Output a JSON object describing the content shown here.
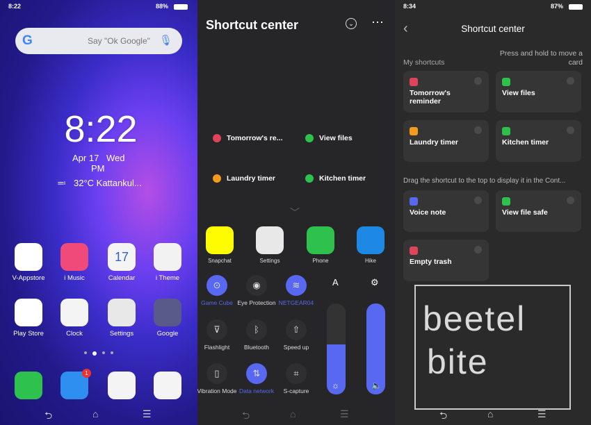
{
  "home": {
    "status_time": "8:22",
    "battery": "88%",
    "search_hint": "Say \"Ok Google\"",
    "clock": "8:22",
    "date": "Apr 17",
    "day": "Wed",
    "ampm": "PM",
    "weather": "32°C Kattankul...",
    "apps": [
      {
        "label": "V-Appstore",
        "color": "#ffffff",
        "icon": "appstore-icon"
      },
      {
        "label": "i Music",
        "color": "#f04a7a",
        "icon": "music-icon"
      },
      {
        "label": "Calendar",
        "color": "#f4f4f4",
        "icon": "calendar-icon",
        "day": "17",
        "weekday": "Wed"
      },
      {
        "label": "i Theme",
        "color": "#f2f2f2",
        "icon": "theme-icon"
      },
      {
        "label": "Play Store",
        "color": "#ffffff",
        "icon": "play-store-icon"
      },
      {
        "label": "Clock",
        "color": "#f4f4f4",
        "icon": "clock-icon"
      },
      {
        "label": "Settings",
        "color": "#e8e8e8",
        "icon": "settings-icon"
      },
      {
        "label": "Google",
        "color": "#5a5a8a",
        "icon": "google-folder-icon"
      }
    ],
    "dock": [
      {
        "icon": "phone-icon",
        "color": "#2ec14d"
      },
      {
        "icon": "messages-icon",
        "color": "#2f8ff0",
        "badge": "1"
      },
      {
        "icon": "browser-icon",
        "color": "#f4f4f4"
      },
      {
        "icon": "camera-icon",
        "color": "#f4f4f4"
      }
    ]
  },
  "control": {
    "title": "Shortcut center",
    "shortcuts": [
      {
        "label": "Tomorrow's re...",
        "color": "#e0445a"
      },
      {
        "label": "View files",
        "color": "#2ec14d"
      },
      {
        "label": "Laundry timer",
        "color": "#f59a1e"
      },
      {
        "label": "Kitchen timer",
        "color": "#2ec14d"
      }
    ],
    "apps": [
      {
        "label": "Snapchat",
        "color": "#fffc00"
      },
      {
        "label": "Settings",
        "color": "#e8e8e8"
      },
      {
        "label": "Phone",
        "color": "#2ec14d"
      },
      {
        "label": "Hike",
        "color": "#1e88e5"
      }
    ],
    "toggles": [
      {
        "label": "Game Cube",
        "on": true,
        "icon": "gamepad-icon",
        "glyph": "⊙"
      },
      {
        "label": "Eye Protection",
        "on": false,
        "icon": "eye-icon",
        "glyph": "◉"
      },
      {
        "label": "NETGEAR04",
        "on": true,
        "icon": "wifi-icon",
        "glyph": "≋"
      },
      {
        "label": "Flashlight",
        "on": false,
        "icon": "flashlight-icon",
        "glyph": "⊽"
      },
      {
        "label": "Bluetooth",
        "on": false,
        "icon": "bluetooth-icon",
        "glyph": "ᛒ"
      },
      {
        "label": "Speed up",
        "on": false,
        "icon": "rocket-icon",
        "glyph": "⇧"
      },
      {
        "label": "Vibration Mode",
        "on": false,
        "icon": "vibration-icon",
        "glyph": "▯"
      },
      {
        "label": "Data network",
        "on": true,
        "icon": "data-network-icon",
        "glyph": "⇅"
      },
      {
        "label": "S-capture",
        "on": false,
        "icon": "screenshot-icon",
        "glyph": "⌗"
      }
    ],
    "auto_label": "A",
    "brightness": 0.55,
    "volume": 1.0,
    "accent": "#5868f0"
  },
  "settings": {
    "status_time": "8:34",
    "battery": "87%",
    "title": "Shortcut center",
    "my_shortcuts": "My shortcuts",
    "hint": "Press and hold to move a card",
    "drag_hint": "Drag the shortcut to the top to display it in the Cont...",
    "cards": [
      {
        "label": "Tomorrow's reminder",
        "color": "#e0445a"
      },
      {
        "label": "View files",
        "color": "#2ec14d"
      },
      {
        "label": "Laundry timer",
        "color": "#f59a1e"
      },
      {
        "label": "Kitchen timer",
        "color": "#2ec14d"
      }
    ],
    "more": [
      {
        "label": "Voice note",
        "color": "#5868f0"
      },
      {
        "label": "View file safe",
        "color": "#2ec14d"
      },
      {
        "label": "Empty trash",
        "color": "#e0445a"
      }
    ],
    "watermark": "beetel bite"
  }
}
